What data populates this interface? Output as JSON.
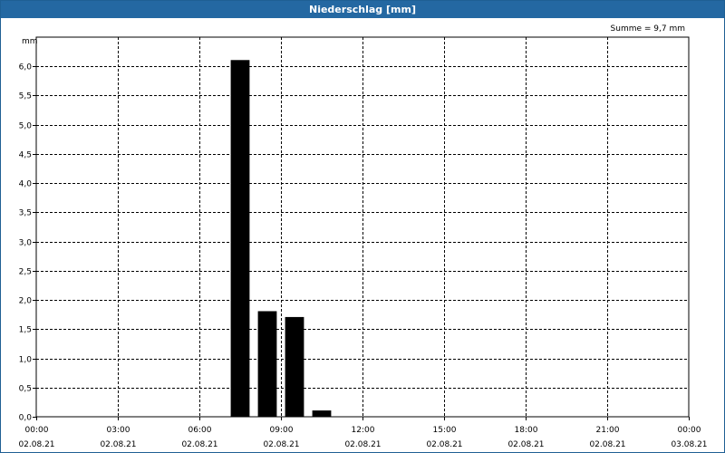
{
  "window": {
    "title": "Niederschlag [mm]"
  },
  "summary_text": "Summe = 9,7 mm",
  "chart_data": {
    "type": "bar",
    "title": "Niederschlag [mm]",
    "ylabel": "mm",
    "xlabel": "",
    "ylim": [
      0,
      6.5
    ],
    "xlim_hours": [
      0,
      24
    ],
    "grid": true,
    "y_ticks": [
      {
        "value": 0,
        "label": "0,0"
      },
      {
        "value": 0.5,
        "label": "0,5"
      },
      {
        "value": 1,
        "label": "1,0"
      },
      {
        "value": 1.5,
        "label": "1,5"
      },
      {
        "value": 2,
        "label": "2,0"
      },
      {
        "value": 2.5,
        "label": "2,5"
      },
      {
        "value": 3,
        "label": "3,0"
      },
      {
        "value": 3.5,
        "label": "3,5"
      },
      {
        "value": 4,
        "label": "4,0"
      },
      {
        "value": 4.5,
        "label": "4,5"
      },
      {
        "value": 5,
        "label": "5,0"
      },
      {
        "value": 5.5,
        "label": "5,5"
      },
      {
        "value": 6,
        "label": "6,0"
      }
    ],
    "x_ticks": [
      {
        "hour": 0,
        "time": "00:00",
        "date": "02.08.21"
      },
      {
        "hour": 3,
        "time": "03:00",
        "date": "02.08.21"
      },
      {
        "hour": 6,
        "time": "06:00",
        "date": "02.08.21"
      },
      {
        "hour": 9,
        "time": "09:00",
        "date": "02.08.21"
      },
      {
        "hour": 12,
        "time": "12:00",
        "date": "02.08.21"
      },
      {
        "hour": 15,
        "time": "15:00",
        "date": "02.08.21"
      },
      {
        "hour": 18,
        "time": "18:00",
        "date": "02.08.21"
      },
      {
        "hour": 21,
        "time": "21:00",
        "date": "02.08.21"
      },
      {
        "hour": 24,
        "time": "00:00",
        "date": "03.08.21"
      }
    ],
    "series": [
      {
        "color": "#000000",
        "points": [
          {
            "start_hour": 7,
            "end_hour": 8,
            "value": 6.1
          },
          {
            "start_hour": 8,
            "end_hour": 9,
            "value": 1.8
          },
          {
            "start_hour": 9,
            "end_hour": 10,
            "value": 1.7
          },
          {
            "start_hour": 10,
            "end_hour": 11,
            "value": 0.1
          }
        ]
      }
    ]
  }
}
